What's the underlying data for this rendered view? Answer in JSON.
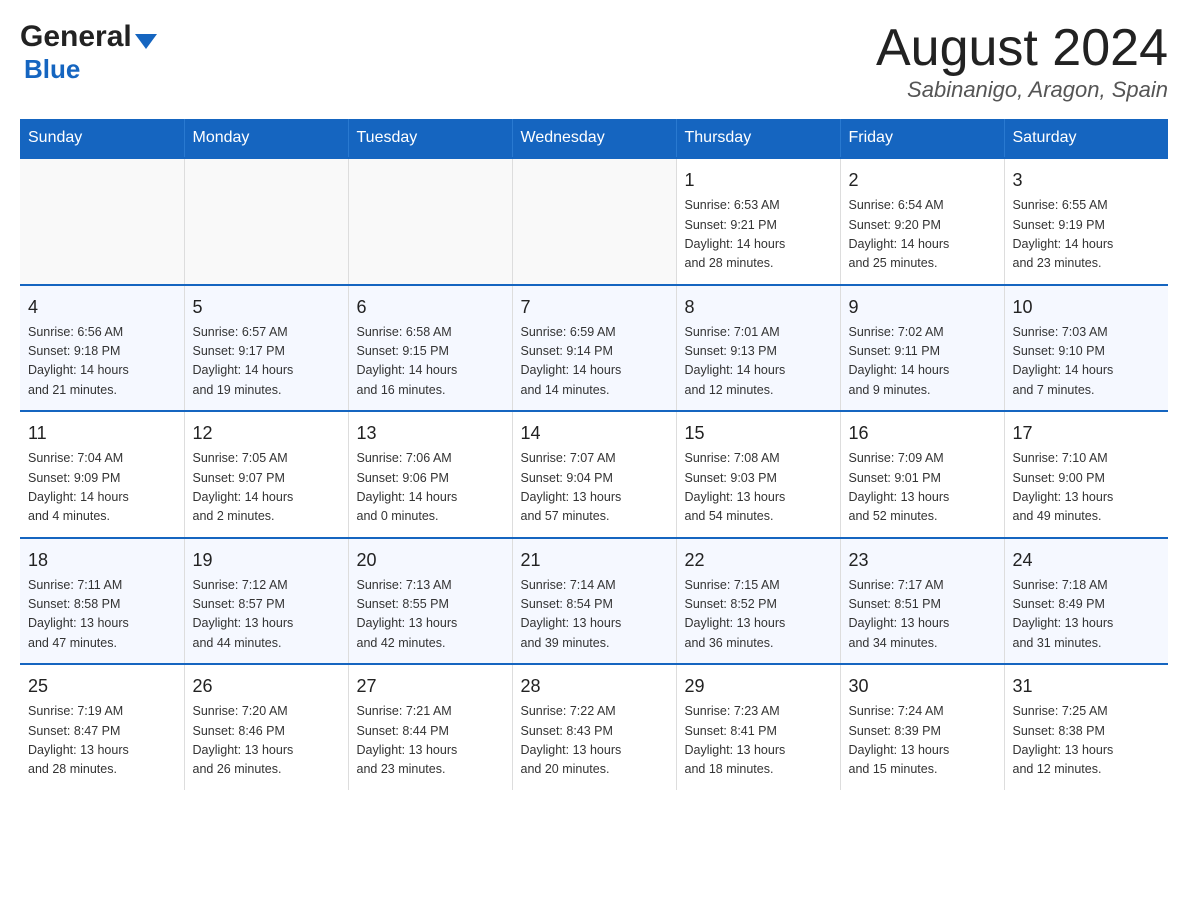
{
  "header": {
    "logo_text": "General",
    "logo_blue": "Blue",
    "month_title": "August 2024",
    "location": "Sabinanigo, Aragon, Spain"
  },
  "days_of_week": [
    "Sunday",
    "Monday",
    "Tuesday",
    "Wednesday",
    "Thursday",
    "Friday",
    "Saturday"
  ],
  "weeks": [
    [
      {
        "day": "",
        "info": ""
      },
      {
        "day": "",
        "info": ""
      },
      {
        "day": "",
        "info": ""
      },
      {
        "day": "",
        "info": ""
      },
      {
        "day": "1",
        "info": "Sunrise: 6:53 AM\nSunset: 9:21 PM\nDaylight: 14 hours\nand 28 minutes."
      },
      {
        "day": "2",
        "info": "Sunrise: 6:54 AM\nSunset: 9:20 PM\nDaylight: 14 hours\nand 25 minutes."
      },
      {
        "day": "3",
        "info": "Sunrise: 6:55 AM\nSunset: 9:19 PM\nDaylight: 14 hours\nand 23 minutes."
      }
    ],
    [
      {
        "day": "4",
        "info": "Sunrise: 6:56 AM\nSunset: 9:18 PM\nDaylight: 14 hours\nand 21 minutes."
      },
      {
        "day": "5",
        "info": "Sunrise: 6:57 AM\nSunset: 9:17 PM\nDaylight: 14 hours\nand 19 minutes."
      },
      {
        "day": "6",
        "info": "Sunrise: 6:58 AM\nSunset: 9:15 PM\nDaylight: 14 hours\nand 16 minutes."
      },
      {
        "day": "7",
        "info": "Sunrise: 6:59 AM\nSunset: 9:14 PM\nDaylight: 14 hours\nand 14 minutes."
      },
      {
        "day": "8",
        "info": "Sunrise: 7:01 AM\nSunset: 9:13 PM\nDaylight: 14 hours\nand 12 minutes."
      },
      {
        "day": "9",
        "info": "Sunrise: 7:02 AM\nSunset: 9:11 PM\nDaylight: 14 hours\nand 9 minutes."
      },
      {
        "day": "10",
        "info": "Sunrise: 7:03 AM\nSunset: 9:10 PM\nDaylight: 14 hours\nand 7 minutes."
      }
    ],
    [
      {
        "day": "11",
        "info": "Sunrise: 7:04 AM\nSunset: 9:09 PM\nDaylight: 14 hours\nand 4 minutes."
      },
      {
        "day": "12",
        "info": "Sunrise: 7:05 AM\nSunset: 9:07 PM\nDaylight: 14 hours\nand 2 minutes."
      },
      {
        "day": "13",
        "info": "Sunrise: 7:06 AM\nSunset: 9:06 PM\nDaylight: 14 hours\nand 0 minutes."
      },
      {
        "day": "14",
        "info": "Sunrise: 7:07 AM\nSunset: 9:04 PM\nDaylight: 13 hours\nand 57 minutes."
      },
      {
        "day": "15",
        "info": "Sunrise: 7:08 AM\nSunset: 9:03 PM\nDaylight: 13 hours\nand 54 minutes."
      },
      {
        "day": "16",
        "info": "Sunrise: 7:09 AM\nSunset: 9:01 PM\nDaylight: 13 hours\nand 52 minutes."
      },
      {
        "day": "17",
        "info": "Sunrise: 7:10 AM\nSunset: 9:00 PM\nDaylight: 13 hours\nand 49 minutes."
      }
    ],
    [
      {
        "day": "18",
        "info": "Sunrise: 7:11 AM\nSunset: 8:58 PM\nDaylight: 13 hours\nand 47 minutes."
      },
      {
        "day": "19",
        "info": "Sunrise: 7:12 AM\nSunset: 8:57 PM\nDaylight: 13 hours\nand 44 minutes."
      },
      {
        "day": "20",
        "info": "Sunrise: 7:13 AM\nSunset: 8:55 PM\nDaylight: 13 hours\nand 42 minutes."
      },
      {
        "day": "21",
        "info": "Sunrise: 7:14 AM\nSunset: 8:54 PM\nDaylight: 13 hours\nand 39 minutes."
      },
      {
        "day": "22",
        "info": "Sunrise: 7:15 AM\nSunset: 8:52 PM\nDaylight: 13 hours\nand 36 minutes."
      },
      {
        "day": "23",
        "info": "Sunrise: 7:17 AM\nSunset: 8:51 PM\nDaylight: 13 hours\nand 34 minutes."
      },
      {
        "day": "24",
        "info": "Sunrise: 7:18 AM\nSunset: 8:49 PM\nDaylight: 13 hours\nand 31 minutes."
      }
    ],
    [
      {
        "day": "25",
        "info": "Sunrise: 7:19 AM\nSunset: 8:47 PM\nDaylight: 13 hours\nand 28 minutes."
      },
      {
        "day": "26",
        "info": "Sunrise: 7:20 AM\nSunset: 8:46 PM\nDaylight: 13 hours\nand 26 minutes."
      },
      {
        "day": "27",
        "info": "Sunrise: 7:21 AM\nSunset: 8:44 PM\nDaylight: 13 hours\nand 23 minutes."
      },
      {
        "day": "28",
        "info": "Sunrise: 7:22 AM\nSunset: 8:43 PM\nDaylight: 13 hours\nand 20 minutes."
      },
      {
        "day": "29",
        "info": "Sunrise: 7:23 AM\nSunset: 8:41 PM\nDaylight: 13 hours\nand 18 minutes."
      },
      {
        "day": "30",
        "info": "Sunrise: 7:24 AM\nSunset: 8:39 PM\nDaylight: 13 hours\nand 15 minutes."
      },
      {
        "day": "31",
        "info": "Sunrise: 7:25 AM\nSunset: 8:38 PM\nDaylight: 13 hours\nand 12 minutes."
      }
    ]
  ]
}
